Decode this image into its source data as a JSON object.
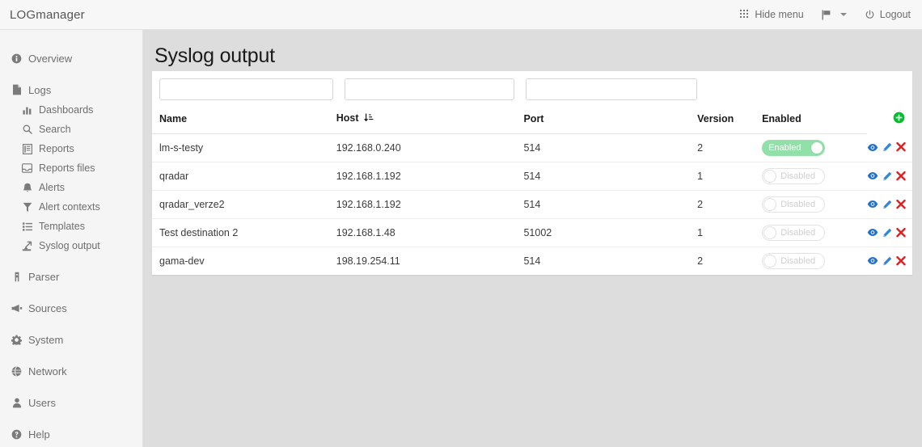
{
  "header": {
    "brand": "LOGmanager",
    "hide_menu_label": "Hide menu",
    "hide_menu_icon": "grid-icon",
    "flag_icon": "flag-icon",
    "logout_label": "Logout",
    "logout_icon": "power-icon"
  },
  "sidebar": {
    "items": [
      {
        "label": "Overview",
        "icon": "info-circle-icon",
        "level": "top"
      },
      {
        "label": "Logs",
        "icon": "file-icon",
        "level": "top"
      },
      {
        "label": "Dashboards",
        "icon": "bar-chart-icon",
        "level": "sub"
      },
      {
        "label": "Search",
        "icon": "search-icon",
        "level": "sub"
      },
      {
        "label": "Reports",
        "icon": "report-icon",
        "level": "sub"
      },
      {
        "label": "Reports files",
        "icon": "inbox-icon",
        "level": "sub"
      },
      {
        "label": "Alerts",
        "icon": "bell-icon",
        "level": "sub"
      },
      {
        "label": "Alert contexts",
        "icon": "filter-icon",
        "level": "sub"
      },
      {
        "label": "Templates",
        "icon": "list-icon",
        "level": "sub"
      },
      {
        "label": "Syslog output",
        "icon": "external-share-icon",
        "level": "sub"
      },
      {
        "label": "Parser",
        "icon": "parser-icon",
        "level": "top"
      },
      {
        "label": "Sources",
        "icon": "megaphone-icon",
        "level": "top"
      },
      {
        "label": "System",
        "icon": "gear-icon",
        "level": "top"
      },
      {
        "label": "Network",
        "icon": "globe-icon",
        "level": "top"
      },
      {
        "label": "Users",
        "icon": "user-icon",
        "level": "top"
      },
      {
        "label": "Help",
        "icon": "question-circle-icon",
        "level": "top"
      }
    ]
  },
  "main": {
    "title": "Syslog output",
    "filters": [
      {
        "name": "filter-name",
        "value": "",
        "placeholder": ""
      },
      {
        "name": "filter-host",
        "value": "",
        "placeholder": ""
      },
      {
        "name": "filter-port",
        "value": "",
        "placeholder": ""
      }
    ],
    "add_icon": "add-circle-icon",
    "table": {
      "columns": [
        "Name",
        "Host",
        "Port",
        "Version",
        "Enabled"
      ],
      "sorted_column": "Host",
      "sort_direction": "asc",
      "sort_icon": "sort-amount-asc-icon",
      "row_actions": [
        {
          "icon": "eye-icon",
          "color": "#1f6fd0"
        },
        {
          "icon": "pencil-icon",
          "color": "#2f86e0"
        },
        {
          "icon": "delete-x-icon",
          "color": "#e02020"
        }
      ],
      "rows": [
        {
          "name": "lm-s-testy",
          "host": "192.168.0.240",
          "port": "514",
          "version": "2",
          "enabled": true,
          "enabled_label": "Enabled"
        },
        {
          "name": "qradar",
          "host": "192.168.1.192",
          "port": "514",
          "version": "1",
          "enabled": false,
          "enabled_label": "Disabled"
        },
        {
          "name": "qradar_verze2",
          "host": "192.168.1.192",
          "port": "514",
          "version": "2",
          "enabled": false,
          "enabled_label": "Disabled"
        },
        {
          "name": "Test destination 2",
          "host": "192.168.1.48",
          "port": "51002",
          "version": "1",
          "enabled": false,
          "enabled_label": "Disabled"
        },
        {
          "name": "gama-dev",
          "host": "198.19.254.11",
          "port": "514",
          "version": "2",
          "enabled": false,
          "enabled_label": "Disabled"
        }
      ]
    }
  },
  "colors": {
    "page_background": "#dddddd",
    "sidebar_background": "#f5f5f5",
    "topbar_background": "#f7f7f7",
    "card_background": "#ffffff",
    "toggle_on": "#92e0a9",
    "add_green": "#00bf2a",
    "action_blue": "#1f6fd0",
    "action_red": "#e02020"
  }
}
